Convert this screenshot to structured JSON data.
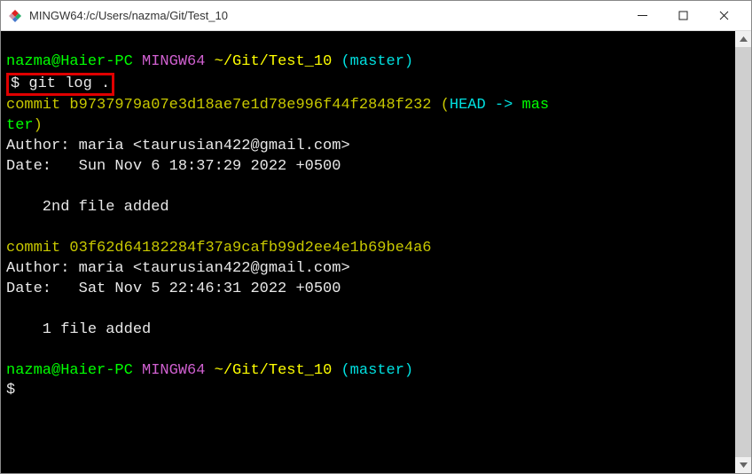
{
  "window": {
    "title": "MINGW64:/c/Users/nazma/Git/Test_10"
  },
  "prompt1": {
    "user_host": "nazma@Haier-PC",
    "env": "MINGW64",
    "path": "~/Git/Test_10",
    "branch": "(master)"
  },
  "command": {
    "symbol": "$",
    "text": "git log ."
  },
  "commits": [
    {
      "hash_label": "commit",
      "hash": "b9737979a07e3d18ae7e1d78e996f44f2848f232",
      "ref_open": " (",
      "ref_head": "HEAD -> ",
      "ref_branch_part1": "mas",
      "ref_branch_part2": "ter",
      "ref_close": ")",
      "author_line": "Author: maria <taurusian422@gmail.com>",
      "date_line": "Date:   Sun Nov 6 18:37:29 2022 +0500",
      "message": "    2nd file added"
    },
    {
      "hash_label": "commit",
      "hash": "03f62d64182284f37a9cafb99d2ee4e1b69be4a6",
      "author_line": "Author: maria <taurusian422@gmail.com>",
      "date_line": "Date:   Sat Nov 5 22:46:31 2022 +0500",
      "message": "    1 file added"
    }
  ],
  "prompt2": {
    "user_host": "nazma@Haier-PC",
    "env": "MINGW64",
    "path": "~/Git/Test_10",
    "branch": "(master)"
  },
  "prompt2_symbol": "$"
}
